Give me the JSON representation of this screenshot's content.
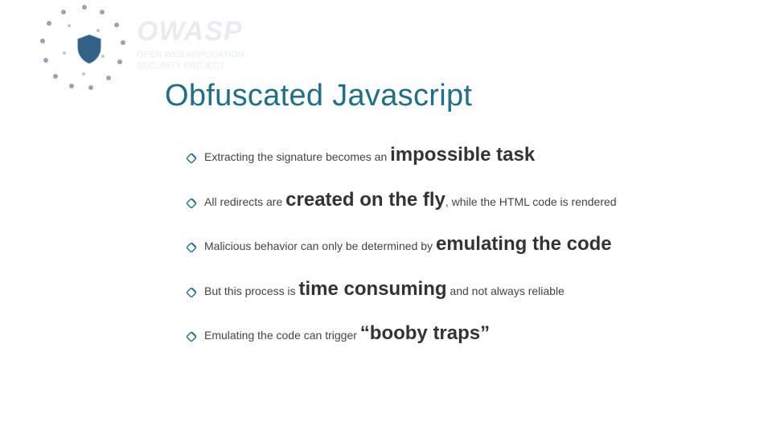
{
  "logo": {
    "wordmark": "OWASP",
    "subline1": "OPEN WEB APPLICATION",
    "subline2": "SECURITY PROJECT",
    "shield_icon": "shield-icon"
  },
  "title": "Obfuscated Javascript",
  "bullets": [
    {
      "pre": "Extracting the signature becomes an ",
      "big": "impossible task",
      "post": ""
    },
    {
      "pre": "All redirects are ",
      "big": "created on the fly",
      "post": ", while the HTML code is rendered"
    },
    {
      "pre": "Malicious behavior can only be determined by ",
      "big": "emulating the code",
      "post": ""
    },
    {
      "pre": "But this process is ",
      "big": "time consuming",
      "post": " and not always reliable"
    },
    {
      "pre": "Emulating the code can trigger ",
      "big": "“booby traps”",
      "post": ""
    }
  ]
}
